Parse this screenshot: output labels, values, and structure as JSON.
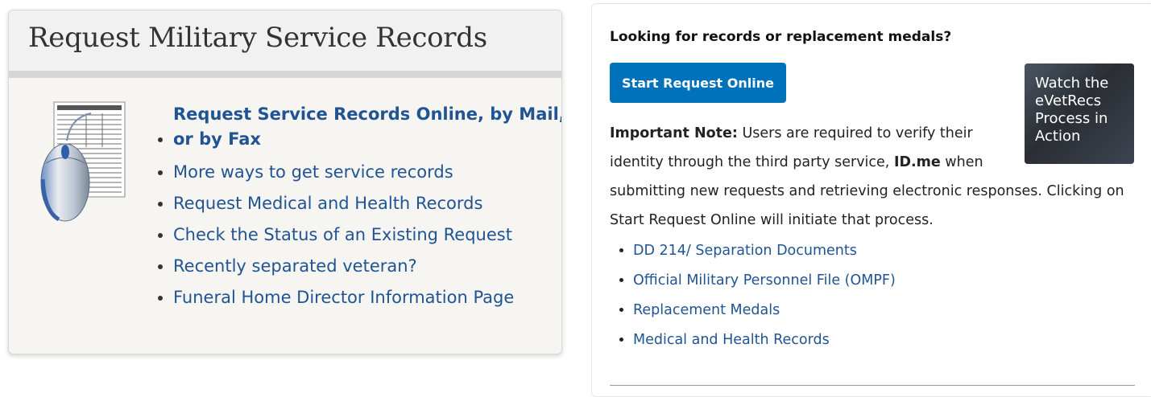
{
  "left": {
    "title": "Request Military Service Records",
    "links": [
      "Request Service Records Online, by Mail, or by Fax",
      "More ways to get service records",
      "Request Medical and Health Records",
      "Check the Status of an Existing Request",
      "Recently separated veteran?",
      "Funeral Home Director Information Page"
    ]
  },
  "right": {
    "heading": "Looking for records or replacement medals?",
    "start_button": "Start Request Online",
    "video_label": "Watch the eVetRecs Process in Action",
    "note_label": "Important Note:",
    "note_text_a": " Users are required to verify their identity through the third party service, ",
    "note_idme": "ID.me",
    "note_text_b": " when",
    "note_text_c": "submitting new requests and retrieving electronic responses. Clicking on Start Request Online will initiate that process.",
    "links": [
      "DD 214/ Separation Documents",
      "Official Military Personnel File (OMPF)",
      "Replacement Medals",
      "Medical and Health Records"
    ]
  },
  "colors": {
    "link": "#205493",
    "button": "#0071bb",
    "card_bg": "#f6f5f2"
  },
  "icons": {
    "illustration": "document-and-mouse-icon"
  }
}
